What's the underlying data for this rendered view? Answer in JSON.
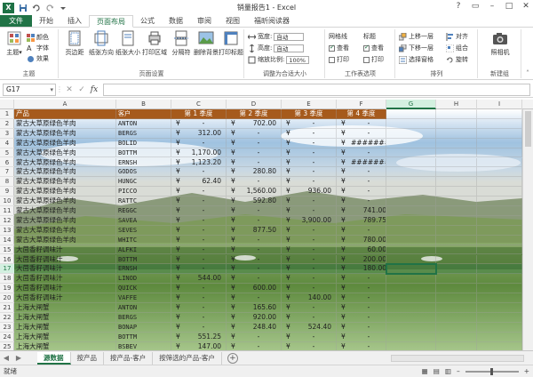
{
  "title": "销量报告1 - Excel",
  "tabs": [
    "文件",
    "开始",
    "插入",
    "页面布局",
    "公式",
    "数据",
    "审阅",
    "视图",
    "福昕阅读器"
  ],
  "active_tab": 3,
  "ribbon": {
    "theme": {
      "themes": "主题",
      "colors": "颜色",
      "fonts": "字体",
      "effects": "效果",
      "label": "主题"
    },
    "page_setup": {
      "margins": "页边距",
      "orientation": "纸张方向",
      "size": "纸张大小",
      "print_area": "打印区域",
      "breaks": "分隔符",
      "background": "删除背景",
      "print_titles": "打印标题",
      "label": "页面设置"
    },
    "scale": {
      "width_label": "宽度:",
      "width_value": "自动",
      "height_label": "高度:",
      "height_value": "自动",
      "scale_label": "缩放比例:",
      "scale_value": "100%",
      "label": "调整为合适大小"
    },
    "sheet_options": {
      "gridlines": "网格线",
      "headings": "标题",
      "view": "查看",
      "print": "打印",
      "label": "工作表选项"
    },
    "arrange": {
      "bring_forward": "上移一层",
      "send_backward": "下移一层",
      "selection_pane": "选择窗格",
      "align": "对齐",
      "group": "组合",
      "rotate": "旋转",
      "label": "排列"
    },
    "new_group": {
      "camera": "照相机",
      "label": "新建组"
    }
  },
  "namebox": "G17",
  "columns": [
    "A",
    "B",
    "C",
    "D",
    "E",
    "F",
    "G",
    "H",
    "I"
  ],
  "selected_col": "G",
  "selected_row": 17,
  "header_row": [
    "产品",
    "客户",
    "第 1 季度",
    "第 2 季度",
    "第 3 季度",
    "第 4 季度"
  ],
  "rows": [
    [
      "蒙古大草原绿色羊肉",
      "ANTON",
      "-",
      "702.00",
      "-",
      "-"
    ],
    [
      "蒙古大草原绿色羊肉",
      "BERGS",
      "312.00",
      "-",
      "-",
      "-"
    ],
    [
      "蒙古大草原绿色羊肉",
      "BOLID",
      "-",
      "-",
      "-",
      "#########"
    ],
    [
      "蒙古大草原绿色羊肉",
      "BOTTM",
      "1,170.00",
      "-",
      "-",
      "-"
    ],
    [
      "蒙古大草原绿色羊肉",
      "ERNSH",
      "1,123.20",
      "-",
      "-",
      "#########"
    ],
    [
      "蒙古大草原绿色羊肉",
      "GODOS",
      "-",
      "280.80",
      "-",
      "-"
    ],
    [
      "蒙古大草原绿色羊肉",
      "HUNGC",
      "62.40",
      "-",
      "-",
      "-"
    ],
    [
      "蒙古大草原绿色羊肉",
      "PICCO",
      "-",
      "1,560.00",
      "936.00",
      "-"
    ],
    [
      "蒙古大草原绿色羊肉",
      "RATTC",
      "-",
      "592.80",
      "-",
      "-"
    ],
    [
      "蒙古大草原绿色羊肉",
      "REGGC",
      "-",
      "-",
      "-",
      "741.00"
    ],
    [
      "蒙古大草原绿色羊肉",
      "SAVEA",
      "-",
      "-",
      "3,900.00",
      "789.75"
    ],
    [
      "蒙古大草原绿色羊肉",
      "SEVES",
      "-",
      "877.50",
      "-",
      "-"
    ],
    [
      "蒙古大草原绿色羊肉",
      "WHITC",
      "-",
      "-",
      "-",
      "780.00"
    ],
    [
      "大茴香籽调味汁",
      "ALFKI",
      "-",
      "-",
      "-",
      "60.00"
    ],
    [
      "大茴香籽调味汁",
      "BOTTM",
      "-",
      "-",
      "-",
      "200.00"
    ],
    [
      "大茴香籽调味汁",
      "ERNSH",
      "-",
      "-",
      "-",
      "180.00"
    ],
    [
      "大茴香籽调味汁",
      "LINOD",
      "544.00",
      "-",
      "-",
      "-"
    ],
    [
      "大茴香籽调味汁",
      "QUICK",
      "-",
      "600.00",
      "-",
      "-"
    ],
    [
      "大茴香籽调味汁",
      "VAFFE",
      "-",
      "-",
      "140.00",
      "-"
    ],
    [
      "上海大闸蟹",
      "ANTON",
      "-",
      "165.60",
      "-",
      "-"
    ],
    [
      "上海大闸蟹",
      "BERGS",
      "-",
      "920.00",
      "-",
      "-"
    ],
    [
      "上海大闸蟹",
      "BONAP",
      "-",
      "248.40",
      "524.40",
      "-"
    ],
    [
      "上海大闸蟹",
      "BOTTM",
      "551.25",
      "-",
      "-",
      "-"
    ],
    [
      "上海大闸蟹",
      "BSBEV",
      "147.00",
      "-",
      "-",
      "-"
    ]
  ],
  "currency": "¥",
  "sheet_tabs": [
    "源数据",
    "按产品",
    "按产品-客户",
    "按筛选的产品-客户"
  ],
  "active_sheet": 0,
  "status": "就绪",
  "accent": "#217346"
}
